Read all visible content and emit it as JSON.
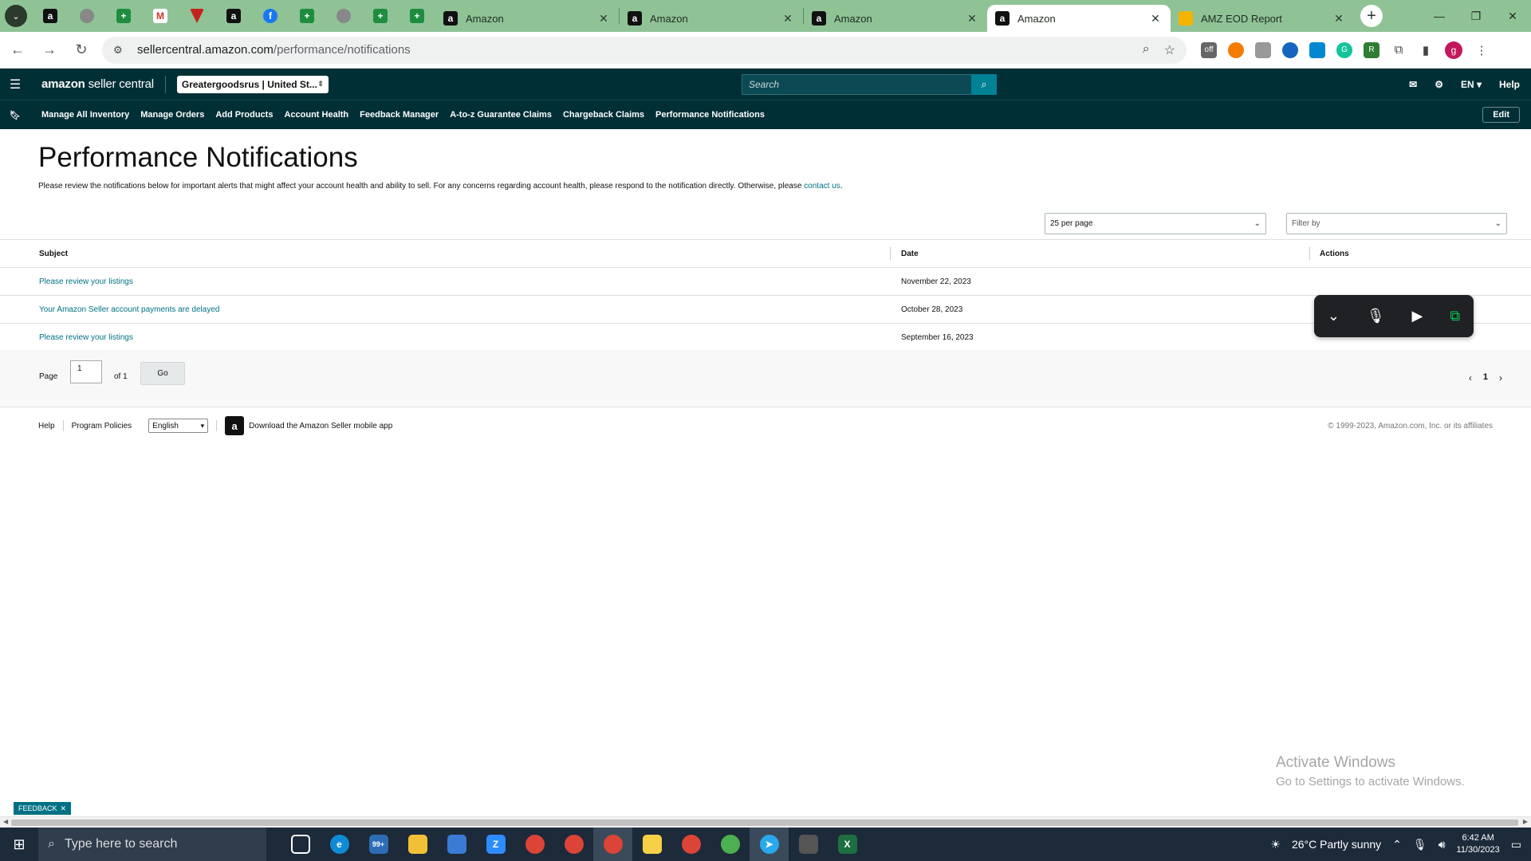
{
  "browser": {
    "tabs": [
      {
        "title": "Amazon",
        "active": false
      },
      {
        "title": "Amazon",
        "active": false
      },
      {
        "title": "Amazon",
        "active": false
      },
      {
        "title": "Amazon",
        "active": true
      },
      {
        "title": "AMZ EOD Report",
        "active": false
      }
    ],
    "url_host": "sellercentral.amazon.com",
    "url_path": "/performance/notifications",
    "profile_initial": "g"
  },
  "header": {
    "logo_brand": "amazon",
    "logo_suffix": "seller central",
    "account": "Greatergoodsrus | United St...",
    "search_placeholder": "Search",
    "language": "EN",
    "help": "Help"
  },
  "nav": {
    "items": [
      "Manage All Inventory",
      "Manage Orders",
      "Add Products",
      "Account Health",
      "Feedback Manager",
      "A-to-z Guarantee Claims",
      "Chargeback Claims",
      "Performance Notifications"
    ],
    "edit": "Edit"
  },
  "page": {
    "title": "Performance Notifications",
    "description": "Please review the notifications below for important alerts that might affect your account health and ability to sell. For any concerns regarding account health, please respond to the notification directly. Otherwise, please",
    "contact_link": "contact us",
    "per_page": "25 per page",
    "filter_placeholder": "Filter by"
  },
  "table": {
    "headers": {
      "subject": "Subject",
      "date": "Date",
      "actions": "Actions"
    },
    "rows": [
      {
        "subject": "Please review your listings",
        "date": "November 22, 2023"
      },
      {
        "subject": "Your Amazon Seller account payments are delayed",
        "date": "October 28, 2023"
      },
      {
        "subject": "Please review your listings",
        "date": "September 16, 2023"
      }
    ]
  },
  "pager": {
    "page_label": "Page",
    "page_value": "1",
    "of_label": "of 1",
    "go": "Go",
    "current": "1"
  },
  "footer": {
    "help": "Help",
    "policies": "Program Policies",
    "language": "English",
    "app_text": "Download the Amazon Seller mobile app",
    "copyright": "© 1999-2023, Amazon.com, Inc. or its affiliates"
  },
  "overlay": {
    "activate_title": "Activate Windows",
    "activate_sub": "Go to Settings to activate Windows.",
    "feedback": "FEEDBACK"
  },
  "taskbar": {
    "search_placeholder": "Type here to search",
    "weather": "26°C  Partly sunny",
    "time": "6:42 AM",
    "date": "11/30/2023",
    "mail_badge": "99+"
  }
}
